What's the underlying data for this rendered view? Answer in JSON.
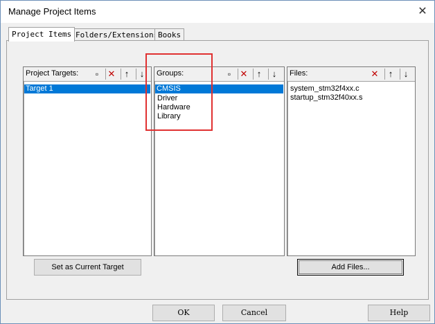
{
  "window": {
    "title": "Manage Project Items"
  },
  "tabs": [
    {
      "label": "Project Items",
      "active": true
    },
    {
      "label": "Folders/Extensions",
      "active": false
    },
    {
      "label": "Books",
      "active": false
    }
  ],
  "targets": {
    "header": "Project Targets:",
    "items": [
      "Target 1"
    ],
    "selected_index": 0
  },
  "groups": {
    "header": "Groups:",
    "items": [
      "CMSIS",
      "Driver",
      "Hardware",
      "Library"
    ],
    "selected_index": 0
  },
  "files": {
    "header": "Files:",
    "items": [
      "system_stm32f4xx.c",
      "startup_stm32f40xx.s"
    ]
  },
  "buttons": {
    "set_current": "Set as Current Target",
    "add_files": "Add Files...",
    "ok": "OK",
    "cancel": "Cancel",
    "help": "Help"
  },
  "icons": {
    "new": "new-item-icon",
    "delete": "delete-icon",
    "move_up": "move-up-icon",
    "move_down": "move-down-icon",
    "close": "close-icon"
  },
  "colors": {
    "selection": "#0078d7",
    "highlight_box": "#e03030",
    "delete_x": "#c00000"
  }
}
